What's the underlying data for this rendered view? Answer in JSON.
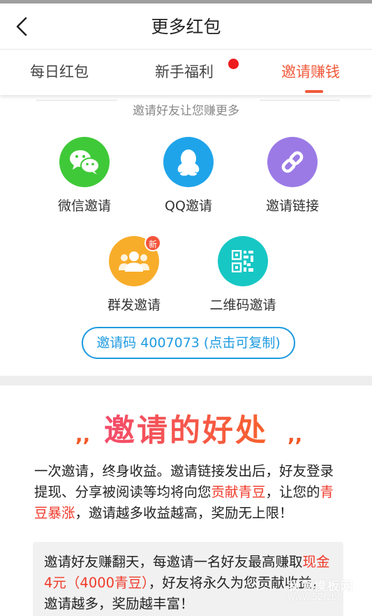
{
  "header": {
    "title": "更多红包",
    "back_icon": "chevron-left-icon"
  },
  "tabs": [
    {
      "label": "每日红包",
      "active": false
    },
    {
      "label": "新手福利",
      "active": false,
      "has_dot": true
    },
    {
      "label": "邀请赚钱",
      "active": true
    }
  ],
  "colors": {
    "accent": "#f05a3a",
    "link_blue": "#1e9be0",
    "dot_red": "#ee1c1c",
    "highlight_red": "#f03a2a"
  },
  "invite": {
    "subtitle": "邀请好友让您赚更多",
    "methods": [
      {
        "label": "微信邀请",
        "icon": "wechat-icon",
        "color": "#3fc938"
      },
      {
        "label": "QQ邀请",
        "icon": "qq-penguin-icon",
        "color": "#1fa4ea"
      },
      {
        "label": "邀请链接",
        "icon": "link-icon",
        "color": "#9b7ae6"
      },
      {
        "label": "群发邀请",
        "icon": "group-icon",
        "color": "#f8ad2a",
        "badge": "新"
      },
      {
        "label": "二维码邀请",
        "icon": "qrcode-icon",
        "color": "#17c7c4"
      }
    ],
    "code_button": "邀请码 4007073 (点击可复制)"
  },
  "benefits": {
    "title": "邀请的好处",
    "paragraph": {
      "p1": "一次邀请，终身收益。邀请链接发出后，好友登录提现、分享被阅读等均将向您",
      "h1": "贡献青豆",
      "p2": "，让您的",
      "h2": "青豆暴涨",
      "p3": "，邀请越多收益越高，奖励无上限！"
    },
    "callout": {
      "p1": "邀请好友赚翻天，每邀请一名好友最高赚取",
      "h1": "现金4元（4000青豆）",
      "p2": "，好友将永久为您贡献收益，邀请越多，奖励越丰富！"
    }
  },
  "watermark": {
    "line1": "我爱模板网",
    "line2": "www.52fzbc"
  }
}
